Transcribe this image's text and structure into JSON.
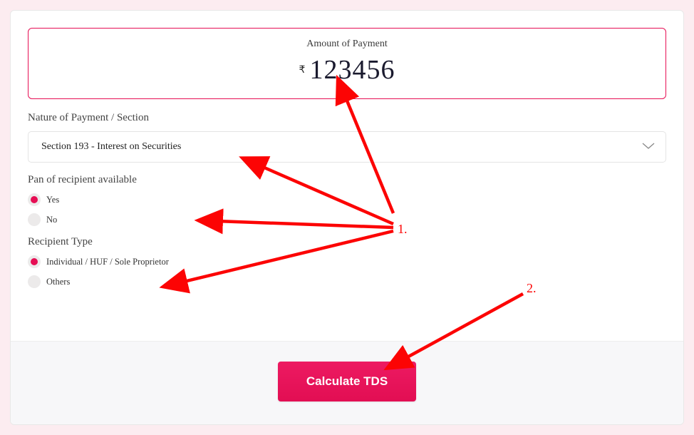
{
  "amount": {
    "label": "Amount of Payment",
    "currency_symbol": "₹",
    "value": "123456"
  },
  "nature": {
    "label": "Nature of Payment / Section",
    "selected": "Section 193 - Interest on Securities"
  },
  "pan": {
    "label": "Pan of recipient available",
    "options": [
      {
        "label": "Yes",
        "selected": true
      },
      {
        "label": "No",
        "selected": false
      }
    ]
  },
  "recipient_type": {
    "label": "Recipient Type",
    "options": [
      {
        "label": "Individual / HUF / Sole Proprietor",
        "selected": true
      },
      {
        "label": "Others",
        "selected": false
      }
    ]
  },
  "button": {
    "label": "Calculate TDS"
  },
  "annotations": {
    "label1": "1.",
    "label2": "2."
  }
}
